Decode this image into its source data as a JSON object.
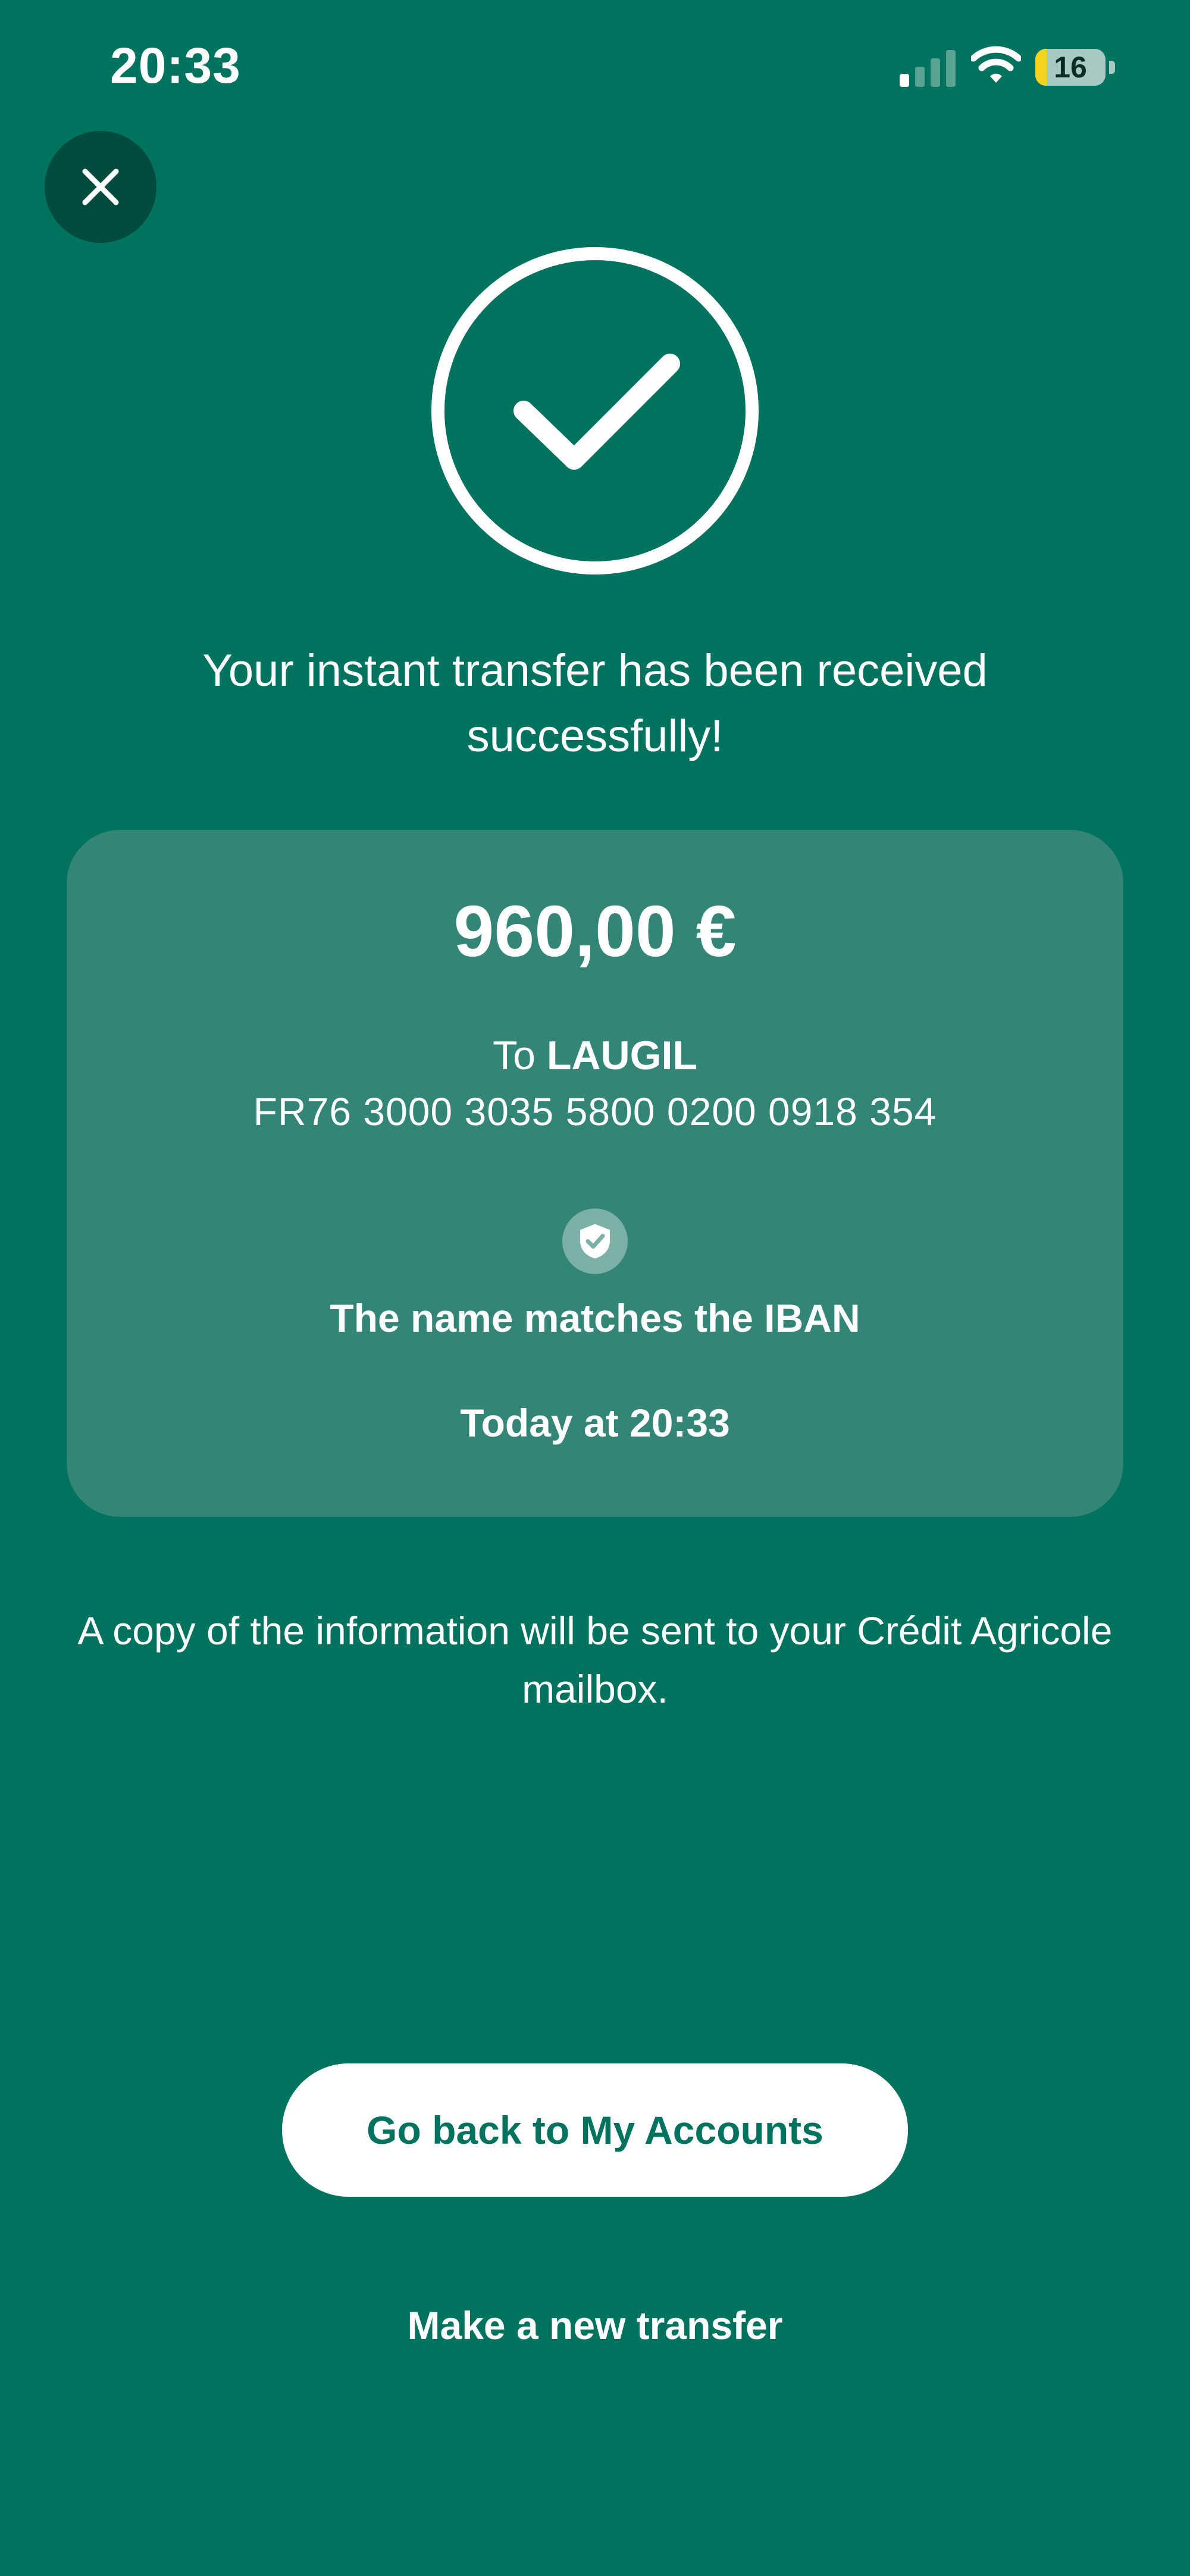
{
  "status_bar": {
    "time": "20:33",
    "battery_level": "16",
    "battery_fraction": 0.16,
    "signal_bars_active": 1,
    "signal_bars_total": 4,
    "icons": [
      "signal-icon",
      "wifi-icon",
      "battery-icon"
    ]
  },
  "close_icon": "close-icon",
  "success_icon": "check-circle-icon",
  "headline": "Your instant transfer has been received successfully!",
  "card": {
    "amount": "960,00 €",
    "to_prefix": "To",
    "recipient": "LAUGIL",
    "iban": "FR76 3000 3035 5800 0200 0918 354",
    "shield_icon": "shield-check-icon",
    "match_text": "The name matches the IBAN",
    "date_text": "Today at 20:33"
  },
  "info_text": "A copy of the information will be sent to your Crédit Agricole mailbox.",
  "actions": {
    "primary_label": "Go back to My Accounts",
    "secondary_label": "Make a new transfer"
  },
  "colors": {
    "background": "#00735E",
    "card": "#338576",
    "close_button": "#024C3F",
    "primary_button_bg": "#ffffff",
    "primary_button_text": "#00735E",
    "battery_fill": "#f4d41d"
  }
}
